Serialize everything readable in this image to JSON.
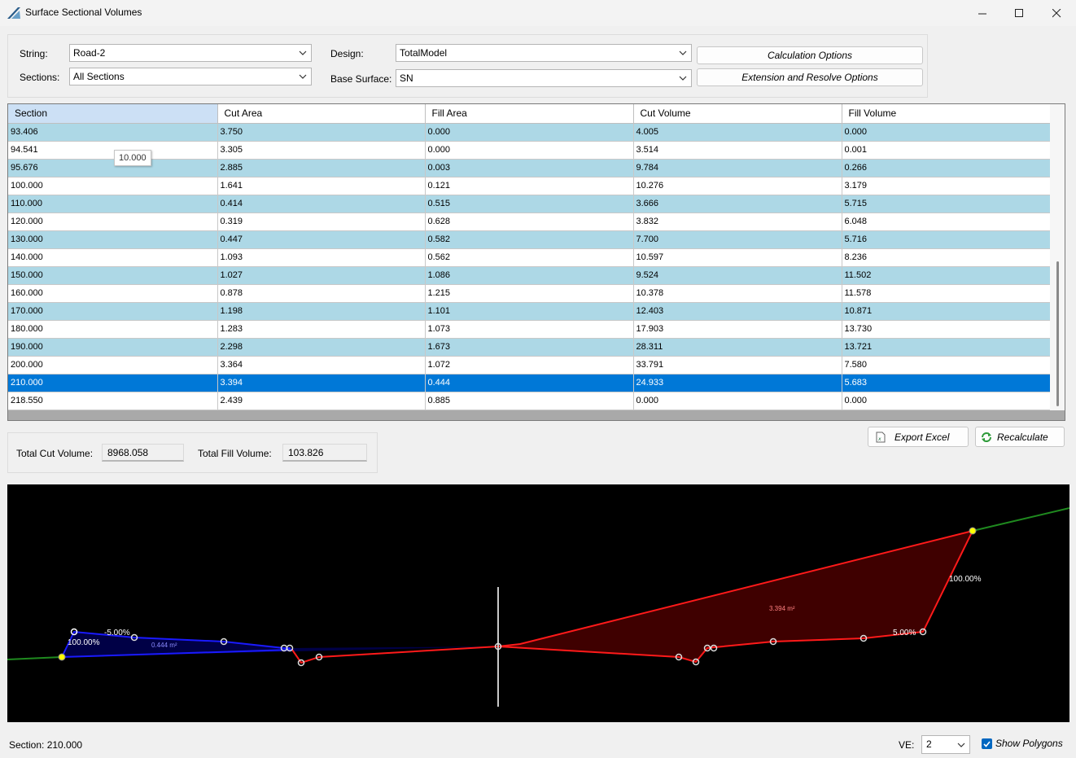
{
  "window": {
    "title": "Surface Sectional Volumes"
  },
  "params": {
    "string_label": "String:",
    "string_value": "Road-2",
    "sections_label": "Sections:",
    "sections_value": "All Sections",
    "design_label": "Design:",
    "design_value": "TotalModel",
    "base_surface_label": "Base Surface:",
    "base_surface_value": "SN",
    "calc_options_label": "Calculation Options",
    "extension_options_label": "Extension and Resolve Options"
  },
  "table": {
    "columns": [
      "Section",
      "Cut Area",
      "Fill Area",
      "Cut Volume",
      "Fill Volume"
    ],
    "rows": [
      [
        "93.406",
        "3.750",
        "0.000",
        "4.005",
        "0.000"
      ],
      [
        "94.541",
        "3.305",
        "0.000",
        "3.514",
        "0.001"
      ],
      [
        "95.676",
        "2.885",
        "0.003",
        "9.784",
        "0.266"
      ],
      [
        "100.000",
        "1.641",
        "0.121",
        "10.276",
        "3.179"
      ],
      [
        "110.000",
        "0.414",
        "0.515",
        "3.666",
        "5.715"
      ],
      [
        "120.000",
        "0.319",
        "0.628",
        "3.832",
        "6.048"
      ],
      [
        "130.000",
        "0.447",
        "0.582",
        "7.700",
        "5.716"
      ],
      [
        "140.000",
        "1.093",
        "0.562",
        "10.597",
        "8.236"
      ],
      [
        "150.000",
        "1.027",
        "1.086",
        "9.524",
        "11.502"
      ],
      [
        "160.000",
        "0.878",
        "1.215",
        "10.378",
        "11.578"
      ],
      [
        "170.000",
        "1.198",
        "1.101",
        "12.403",
        "10.871"
      ],
      [
        "180.000",
        "1.283",
        "1.073",
        "17.903",
        "13.730"
      ],
      [
        "190.000",
        "2.298",
        "1.673",
        "28.311",
        "13.721"
      ],
      [
        "200.000",
        "3.364",
        "1.072",
        "33.791",
        "7.580"
      ],
      [
        "210.000",
        "3.394",
        "0.444",
        "24.933",
        "5.683"
      ],
      [
        "218.550",
        "2.439",
        "0.885",
        "0.000",
        "0.000"
      ]
    ],
    "selected_row": 14,
    "tooltip": "10.000"
  },
  "totals": {
    "cut_label": "Total Cut Volume:",
    "cut_value": "8968.058",
    "fill_label": "Total Fill Volume:",
    "fill_value": "103.826"
  },
  "actions": {
    "export_label": "Export Excel",
    "recalc_label": "Recalculate"
  },
  "section_view": {
    "fill_area_label": "0.444 m²",
    "cut_area_label": "3.394 m²",
    "left_grade_label": "-5.00%",
    "left_slope_label": "100.00%",
    "right_grade_label": "5.00%",
    "right_slope_label": "100.00%",
    "colors": {
      "fill": "#0000ff",
      "cut": "#ff0000",
      "ground": "#008000",
      "background": "#000000"
    }
  },
  "status": {
    "section_text": "Section: 210.000",
    "ve_label": "VE:",
    "ve_value": "2",
    "show_polygons_label": "Show Polygons",
    "show_polygons_checked": true
  }
}
